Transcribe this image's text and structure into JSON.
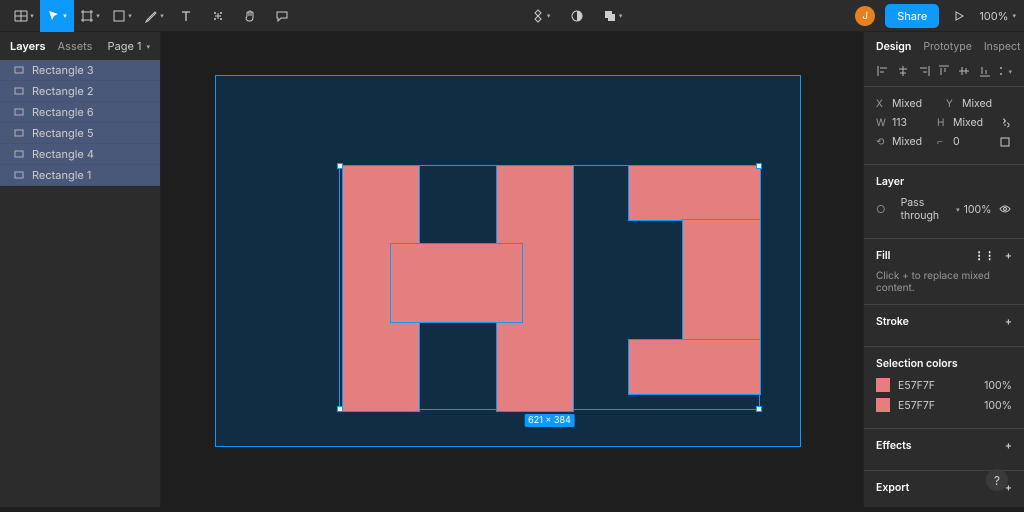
{
  "toolbar": {
    "zoom": "100%",
    "share": "Share"
  },
  "avatar": {
    "initial": "J"
  },
  "left_panel": {
    "tabs": {
      "layers": "Layers",
      "assets": "Assets"
    },
    "page": "Page 1",
    "items": [
      {
        "name": "Rectangle 3"
      },
      {
        "name": "Rectangle 2"
      },
      {
        "name": "Rectangle 6"
      },
      {
        "name": "Rectangle 5"
      },
      {
        "name": "Rectangle 4"
      },
      {
        "name": "Rectangle 1"
      }
    ]
  },
  "right_panel": {
    "tabs": {
      "design": "Design",
      "prototype": "Prototype",
      "inspect": "Inspect"
    },
    "transform": {
      "x_label": "X",
      "x": "Mixed",
      "y_label": "Y",
      "y": "Mixed",
      "w_label": "W",
      "w": "113",
      "h_label": "H",
      "h": "Mixed",
      "rot": "Mixed",
      "corner": "0"
    },
    "layer": {
      "title": "Layer",
      "mode": "Pass through",
      "opacity": "100%"
    },
    "fill": {
      "title": "Fill",
      "hint": "Click + to replace mixed content."
    },
    "stroke": {
      "title": "Stroke"
    },
    "selection": {
      "title": "Selection colors",
      "items": [
        {
          "hex": "E57F7F",
          "pct": "100%"
        },
        {
          "hex": "E57F7F",
          "pct": "100%"
        }
      ]
    },
    "effects": {
      "title": "Effects"
    },
    "export": {
      "title": "Export"
    }
  },
  "canvas": {
    "selection_label": "621 × 384"
  }
}
